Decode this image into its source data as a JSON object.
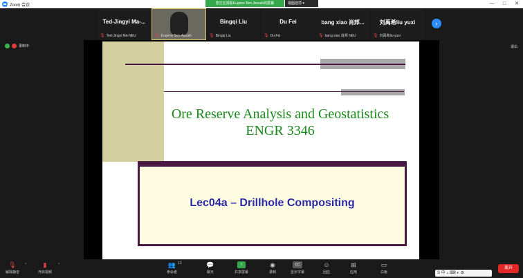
{
  "window": {
    "title": "Zoom 会议",
    "controls": [
      "—",
      "□",
      "✕"
    ]
  },
  "banner": {
    "viewing": "您正在观看Eugene Ben-Awuah的屏幕",
    "view_options": "视图选项 ▾"
  },
  "participants": [
    {
      "display": "Ted-Jingyi Ma-...",
      "name": "Ted-Jingyi Ma-NEU",
      "video": false
    },
    {
      "display": "",
      "name": "Eugene Ben-Awuah",
      "video": true
    },
    {
      "display": "Bingqi Liu",
      "name": "Bingqi Liu",
      "video": false
    },
    {
      "display": "Du Fei",
      "name": "Du Fei",
      "video": false
    },
    {
      "display": "bang xiao 肖邦...",
      "name": "bang xiao 肖邦 NEU",
      "video": false
    },
    {
      "display": "刘禹希liu yuxi",
      "name": "刘禹希liu yuxi",
      "video": false
    }
  ],
  "recording": {
    "label": "录制中"
  },
  "exit_fullscreen": "退出",
  "slide": {
    "title_line1": "Ore Reserve Analysis and Geostatistics",
    "title_line2": "ENGR 3346",
    "subtitle": "Lec04a – Drillhole Compositing",
    "colors": {
      "title": "#1a8a1a",
      "subtitle": "#2a2aa8",
      "accent": "#4a1a44",
      "tan": "#d5d0a0"
    }
  },
  "toolbar": {
    "unmute": "解除静音",
    "start_video": "开启视频",
    "participants": "参会者",
    "participant_count": "13",
    "chat": "聊天",
    "share": "共享屏幕",
    "record": "录制",
    "captions": "显示字幕",
    "captions_badge": "CC",
    "reactions": "回应",
    "apps": "应用",
    "whiteboard": "白板",
    "leave": "离开"
  },
  "ime": "S 中 ♪ ⌨ ◐ ⚙"
}
